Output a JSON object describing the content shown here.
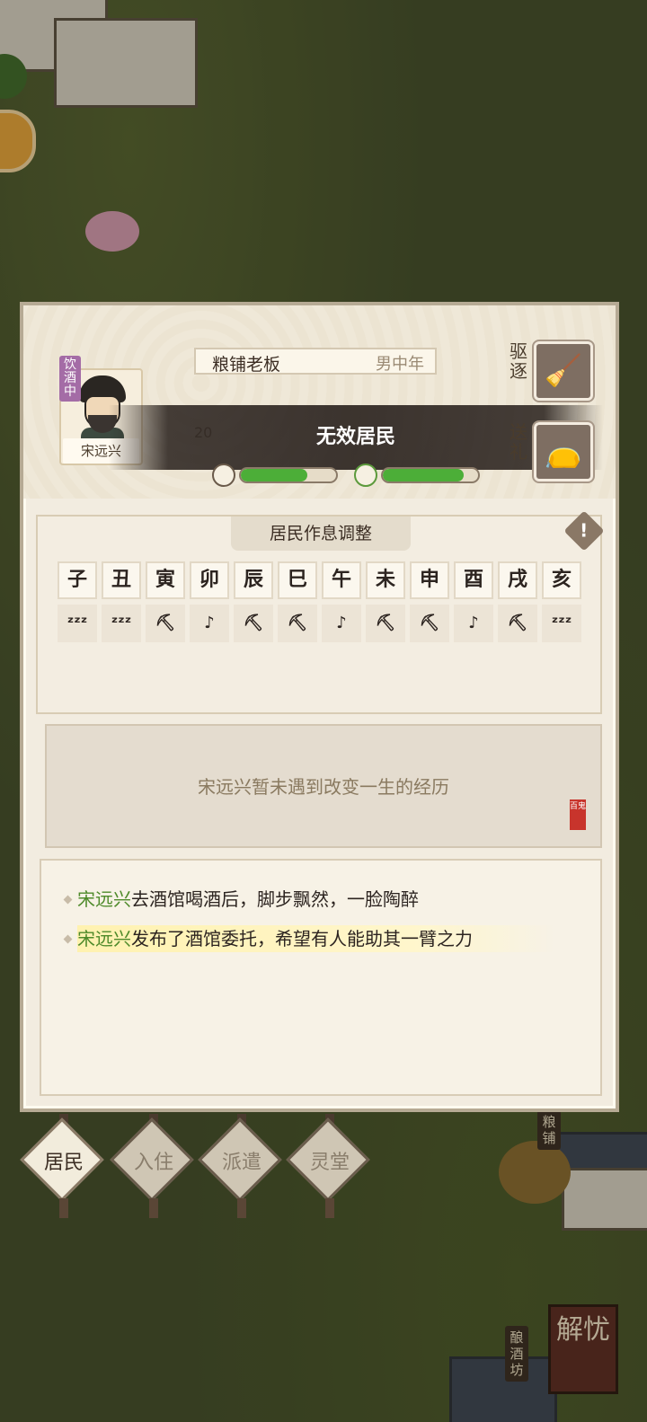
{
  "resident": {
    "name": "宋远兴",
    "status_tag": "饮酒中",
    "job": "粮铺老板",
    "demographic": "男中年",
    "row2_value": "20",
    "invalid_banner": "无效居民",
    "mood_percent": 70,
    "vitality_percent": 85
  },
  "actions": {
    "expel_label": "驱逐",
    "gift_label": "送礼"
  },
  "schedule": {
    "title": "居民作息调整",
    "hours": [
      "子",
      "丑",
      "寅",
      "卯",
      "辰",
      "巳",
      "午",
      "未",
      "申",
      "酉",
      "戌",
      "亥"
    ],
    "activities": [
      {
        "icon": "sleep-icon",
        "glyph": "ᶻᶻᶻ"
      },
      {
        "icon": "sleep-icon",
        "glyph": "ᶻᶻᶻ"
      },
      {
        "icon": "work-pickaxe-icon",
        "glyph": "⛏"
      },
      {
        "icon": "leisure-icon",
        "glyph": "♪"
      },
      {
        "icon": "work-pickaxe-icon",
        "glyph": "⛏"
      },
      {
        "icon": "work-pickaxe-icon",
        "glyph": "⛏"
      },
      {
        "icon": "leisure-icon",
        "glyph": "♪"
      },
      {
        "icon": "work-pickaxe-icon",
        "glyph": "⛏"
      },
      {
        "icon": "work-pickaxe-icon",
        "glyph": "⛏"
      },
      {
        "icon": "leisure-icon",
        "glyph": "♪"
      },
      {
        "icon": "work-pickaxe-icon",
        "glyph": "⛏"
      },
      {
        "icon": "sleep-icon",
        "glyph": "ᶻᶻᶻ"
      }
    ]
  },
  "life_event": {
    "text": "宋远兴暂未遇到改变一生的经历",
    "seal_text": "百鬼"
  },
  "log": [
    {
      "name": "宋远兴",
      "text": "去酒馆喝酒后，脚步飘然，一脸陶醉"
    },
    {
      "name": "宋远兴",
      "text": "发布了酒馆委托，希望有人能助其一臂之力"
    }
  ],
  "tabs": [
    {
      "label": "居民",
      "active": true
    },
    {
      "label": "入住",
      "active": false
    },
    {
      "label": "派遣",
      "active": false
    },
    {
      "label": "灵堂",
      "active": false
    }
  ],
  "world": {
    "sign_grain": "粮铺",
    "sign_brewery": "酿酒坊",
    "solve_button": "解忧"
  }
}
